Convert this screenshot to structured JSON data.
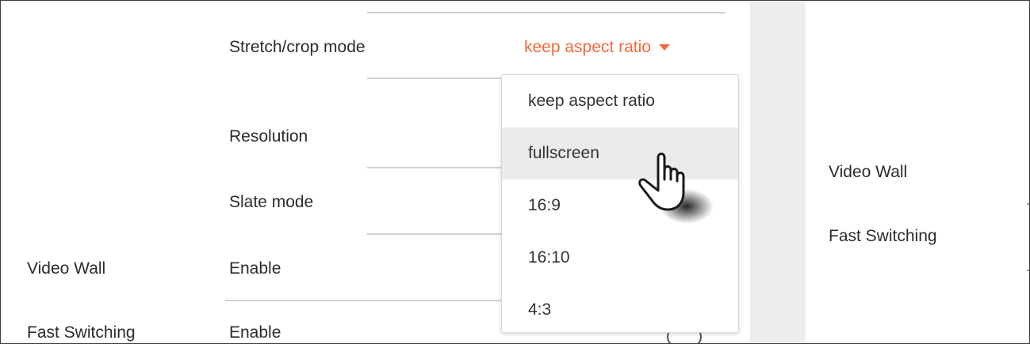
{
  "settings": {
    "stretch_crop_label": "Stretch/crop mode",
    "resolution_label": "Resolution",
    "slate_mode_label": "Slate mode",
    "stretch_crop_value": "keep aspect ratio",
    "video_wall_section": "Video Wall",
    "video_wall_enable": "Enable",
    "fast_switching_section": "Fast Switching",
    "fast_switching_enable": "Enable"
  },
  "dropdown": {
    "options": [
      "keep aspect ratio",
      "fullscreen",
      "16:9",
      "16:10",
      "4:3"
    ],
    "hovered": "fullscreen"
  },
  "right_panel": {
    "video_wall": "Video Wall",
    "fast_switching": "Fast Switching"
  },
  "colors": {
    "accent": "#f26a3e",
    "hover_bg": "#ebebeb",
    "gutter": "#ececec"
  },
  "icons": {
    "caret": "caret-down-icon",
    "cursor": "hand-pointer-icon"
  }
}
